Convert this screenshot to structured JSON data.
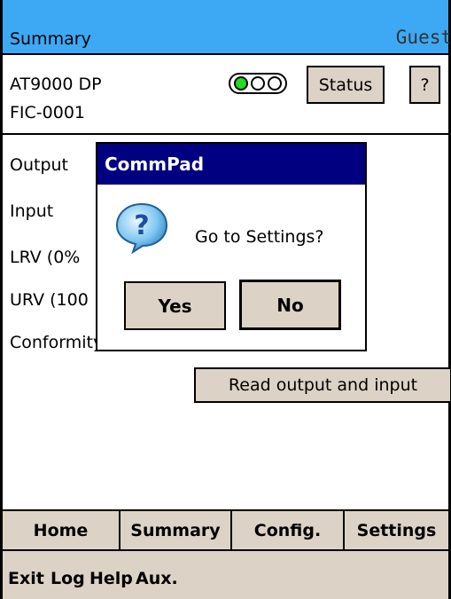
{
  "titlebar": {
    "title": "Summary",
    "user": "Guest"
  },
  "device": {
    "model": "AT9000 DP",
    "tag": "FIC-0001",
    "status_label": "Status",
    "help_label": "?"
  },
  "colors": {
    "titlebar": "#3da9f5",
    "dialog_title": "#000080",
    "button": "#ddd2c6",
    "light_green": "#22dd22"
  },
  "fields": [
    {
      "label": "Output"
    },
    {
      "label": "Input"
    },
    {
      "label": "LRV (0%"
    },
    {
      "label": "URV (100"
    },
    {
      "label": "Conformity"
    }
  ],
  "read_button": "Read output and input",
  "dialog": {
    "title": "CommPad",
    "message": "Go to Settings?",
    "yes": "Yes",
    "no": "No",
    "icon": "question-icon"
  },
  "nav": {
    "tabs": [
      "Home",
      "Summary",
      "Config.",
      "Settings"
    ]
  },
  "menubar": {
    "items": [
      "Exit",
      "Log",
      "Help",
      "Aux."
    ]
  }
}
